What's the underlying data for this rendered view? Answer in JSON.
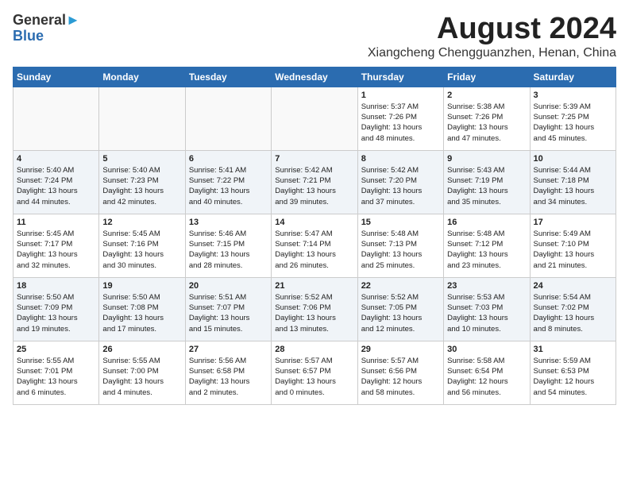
{
  "logo": {
    "line1": "General",
    "line2": "Blue"
  },
  "header": {
    "month_year": "August 2024",
    "location": "Xiangcheng Chengguanzhen, Henan, China"
  },
  "weekdays": [
    "Sunday",
    "Monday",
    "Tuesday",
    "Wednesday",
    "Thursday",
    "Friday",
    "Saturday"
  ],
  "weeks": [
    [
      {
        "day": "",
        "content": ""
      },
      {
        "day": "",
        "content": ""
      },
      {
        "day": "",
        "content": ""
      },
      {
        "day": "",
        "content": ""
      },
      {
        "day": "1",
        "content": "Sunrise: 5:37 AM\nSunset: 7:26 PM\nDaylight: 13 hours\nand 48 minutes."
      },
      {
        "day": "2",
        "content": "Sunrise: 5:38 AM\nSunset: 7:26 PM\nDaylight: 13 hours\nand 47 minutes."
      },
      {
        "day": "3",
        "content": "Sunrise: 5:39 AM\nSunset: 7:25 PM\nDaylight: 13 hours\nand 45 minutes."
      }
    ],
    [
      {
        "day": "4",
        "content": "Sunrise: 5:40 AM\nSunset: 7:24 PM\nDaylight: 13 hours\nand 44 minutes."
      },
      {
        "day": "5",
        "content": "Sunrise: 5:40 AM\nSunset: 7:23 PM\nDaylight: 13 hours\nand 42 minutes."
      },
      {
        "day": "6",
        "content": "Sunrise: 5:41 AM\nSunset: 7:22 PM\nDaylight: 13 hours\nand 40 minutes."
      },
      {
        "day": "7",
        "content": "Sunrise: 5:42 AM\nSunset: 7:21 PM\nDaylight: 13 hours\nand 39 minutes."
      },
      {
        "day": "8",
        "content": "Sunrise: 5:42 AM\nSunset: 7:20 PM\nDaylight: 13 hours\nand 37 minutes."
      },
      {
        "day": "9",
        "content": "Sunrise: 5:43 AM\nSunset: 7:19 PM\nDaylight: 13 hours\nand 35 minutes."
      },
      {
        "day": "10",
        "content": "Sunrise: 5:44 AM\nSunset: 7:18 PM\nDaylight: 13 hours\nand 34 minutes."
      }
    ],
    [
      {
        "day": "11",
        "content": "Sunrise: 5:45 AM\nSunset: 7:17 PM\nDaylight: 13 hours\nand 32 minutes."
      },
      {
        "day": "12",
        "content": "Sunrise: 5:45 AM\nSunset: 7:16 PM\nDaylight: 13 hours\nand 30 minutes."
      },
      {
        "day": "13",
        "content": "Sunrise: 5:46 AM\nSunset: 7:15 PM\nDaylight: 13 hours\nand 28 minutes."
      },
      {
        "day": "14",
        "content": "Sunrise: 5:47 AM\nSunset: 7:14 PM\nDaylight: 13 hours\nand 26 minutes."
      },
      {
        "day": "15",
        "content": "Sunrise: 5:48 AM\nSunset: 7:13 PM\nDaylight: 13 hours\nand 25 minutes."
      },
      {
        "day": "16",
        "content": "Sunrise: 5:48 AM\nSunset: 7:12 PM\nDaylight: 13 hours\nand 23 minutes."
      },
      {
        "day": "17",
        "content": "Sunrise: 5:49 AM\nSunset: 7:10 PM\nDaylight: 13 hours\nand 21 minutes."
      }
    ],
    [
      {
        "day": "18",
        "content": "Sunrise: 5:50 AM\nSunset: 7:09 PM\nDaylight: 13 hours\nand 19 minutes."
      },
      {
        "day": "19",
        "content": "Sunrise: 5:50 AM\nSunset: 7:08 PM\nDaylight: 13 hours\nand 17 minutes."
      },
      {
        "day": "20",
        "content": "Sunrise: 5:51 AM\nSunset: 7:07 PM\nDaylight: 13 hours\nand 15 minutes."
      },
      {
        "day": "21",
        "content": "Sunrise: 5:52 AM\nSunset: 7:06 PM\nDaylight: 13 hours\nand 13 minutes."
      },
      {
        "day": "22",
        "content": "Sunrise: 5:52 AM\nSunset: 7:05 PM\nDaylight: 13 hours\nand 12 minutes."
      },
      {
        "day": "23",
        "content": "Sunrise: 5:53 AM\nSunset: 7:03 PM\nDaylight: 13 hours\nand 10 minutes."
      },
      {
        "day": "24",
        "content": "Sunrise: 5:54 AM\nSunset: 7:02 PM\nDaylight: 13 hours\nand 8 minutes."
      }
    ],
    [
      {
        "day": "25",
        "content": "Sunrise: 5:55 AM\nSunset: 7:01 PM\nDaylight: 13 hours\nand 6 minutes."
      },
      {
        "day": "26",
        "content": "Sunrise: 5:55 AM\nSunset: 7:00 PM\nDaylight: 13 hours\nand 4 minutes."
      },
      {
        "day": "27",
        "content": "Sunrise: 5:56 AM\nSunset: 6:58 PM\nDaylight: 13 hours\nand 2 minutes."
      },
      {
        "day": "28",
        "content": "Sunrise: 5:57 AM\nSunset: 6:57 PM\nDaylight: 13 hours\nand 0 minutes."
      },
      {
        "day": "29",
        "content": "Sunrise: 5:57 AM\nSunset: 6:56 PM\nDaylight: 12 hours\nand 58 minutes."
      },
      {
        "day": "30",
        "content": "Sunrise: 5:58 AM\nSunset: 6:54 PM\nDaylight: 12 hours\nand 56 minutes."
      },
      {
        "day": "31",
        "content": "Sunrise: 5:59 AM\nSunset: 6:53 PM\nDaylight: 12 hours\nand 54 minutes."
      }
    ]
  ]
}
